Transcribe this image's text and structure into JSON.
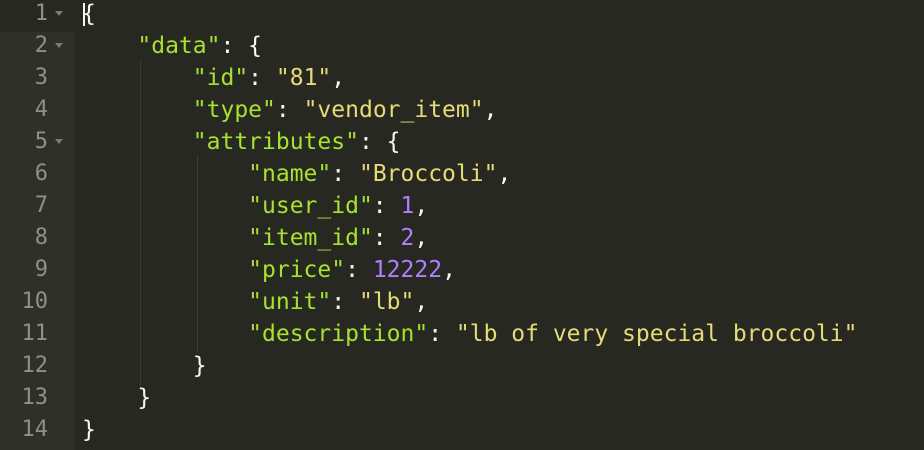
{
  "editor": {
    "lines": [
      {
        "num": "1",
        "fold": true,
        "tokens": [
          {
            "t": "{",
            "c": "p"
          }
        ]
      },
      {
        "num": "2",
        "fold": true,
        "tokens": [
          {
            "t": "    ",
            "c": "p"
          },
          {
            "t": "\"data\"",
            "c": "k"
          },
          {
            "t": ": {",
            "c": "p"
          }
        ]
      },
      {
        "num": "3",
        "fold": false,
        "tokens": [
          {
            "t": "        ",
            "c": "p"
          },
          {
            "t": "\"id\"",
            "c": "k"
          },
          {
            "t": ": ",
            "c": "p"
          },
          {
            "t": "\"81\"",
            "c": "s"
          },
          {
            "t": ",",
            "c": "p"
          }
        ]
      },
      {
        "num": "4",
        "fold": false,
        "tokens": [
          {
            "t": "        ",
            "c": "p"
          },
          {
            "t": "\"type\"",
            "c": "k"
          },
          {
            "t": ": ",
            "c": "p"
          },
          {
            "t": "\"vendor_item\"",
            "c": "s"
          },
          {
            "t": ",",
            "c": "p"
          }
        ]
      },
      {
        "num": "5",
        "fold": true,
        "tokens": [
          {
            "t": "        ",
            "c": "p"
          },
          {
            "t": "\"attributes\"",
            "c": "k"
          },
          {
            "t": ": {",
            "c": "p"
          }
        ]
      },
      {
        "num": "6",
        "fold": false,
        "tokens": [
          {
            "t": "            ",
            "c": "p"
          },
          {
            "t": "\"name\"",
            "c": "k"
          },
          {
            "t": ": ",
            "c": "p"
          },
          {
            "t": "\"Broccoli\"",
            "c": "s"
          },
          {
            "t": ",",
            "c": "p"
          }
        ]
      },
      {
        "num": "7",
        "fold": false,
        "tokens": [
          {
            "t": "            ",
            "c": "p"
          },
          {
            "t": "\"user_id\"",
            "c": "k"
          },
          {
            "t": ": ",
            "c": "p"
          },
          {
            "t": "1",
            "c": "n"
          },
          {
            "t": ",",
            "c": "p"
          }
        ]
      },
      {
        "num": "8",
        "fold": false,
        "tokens": [
          {
            "t": "            ",
            "c": "p"
          },
          {
            "t": "\"item_id\"",
            "c": "k"
          },
          {
            "t": ": ",
            "c": "p"
          },
          {
            "t": "2",
            "c": "n"
          },
          {
            "t": ",",
            "c": "p"
          }
        ]
      },
      {
        "num": "9",
        "fold": false,
        "tokens": [
          {
            "t": "            ",
            "c": "p"
          },
          {
            "t": "\"price\"",
            "c": "k"
          },
          {
            "t": ": ",
            "c": "p"
          },
          {
            "t": "12222",
            "c": "n"
          },
          {
            "t": ",",
            "c": "p"
          }
        ]
      },
      {
        "num": "10",
        "fold": false,
        "tokens": [
          {
            "t": "            ",
            "c": "p"
          },
          {
            "t": "\"unit\"",
            "c": "k"
          },
          {
            "t": ": ",
            "c": "p"
          },
          {
            "t": "\"lb\"",
            "c": "s"
          },
          {
            "t": ",",
            "c": "p"
          }
        ]
      },
      {
        "num": "11",
        "fold": false,
        "tokens": [
          {
            "t": "            ",
            "c": "p"
          },
          {
            "t": "\"description\"",
            "c": "k"
          },
          {
            "t": ": ",
            "c": "p"
          },
          {
            "t": "\"lb of very special broccoli\"",
            "c": "s"
          }
        ]
      },
      {
        "num": "12",
        "fold": false,
        "tokens": [
          {
            "t": "        ",
            "c": "p"
          },
          {
            "t": "}",
            "c": "p"
          }
        ]
      },
      {
        "num": "13",
        "fold": false,
        "tokens": [
          {
            "t": "    ",
            "c": "p"
          },
          {
            "t": "}",
            "c": "p"
          }
        ]
      },
      {
        "num": "14",
        "fold": false,
        "tokens": [
          {
            "t": "}",
            "c": "p"
          }
        ]
      }
    ],
    "colors": {
      "background": "#272822",
      "gutter": "#2f3129",
      "key": "#a6e22e",
      "string": "#e6db74",
      "number": "#ae81ff",
      "punctuation": "#f8f8f2",
      "line_number": "#8f908a"
    }
  }
}
